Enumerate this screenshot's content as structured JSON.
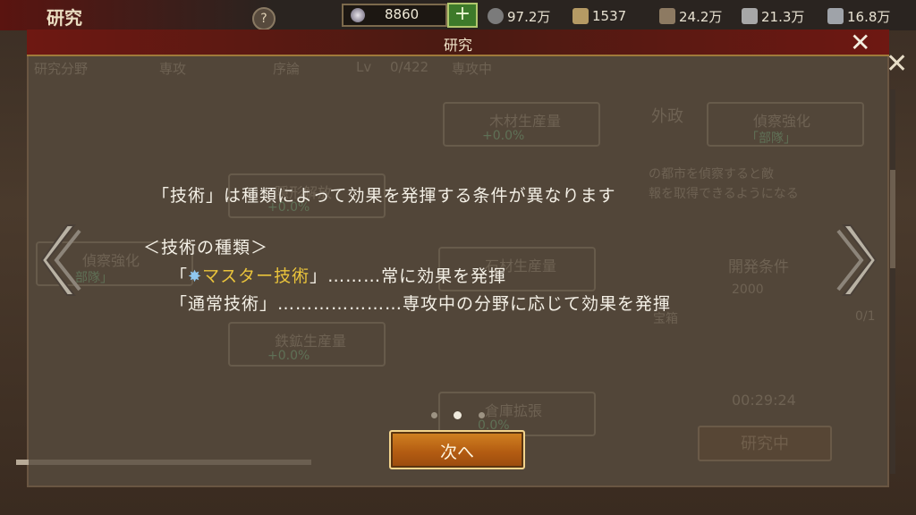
{
  "background": {
    "title": "研究",
    "help_label": "?",
    "gold": "8860",
    "plus_label": "+",
    "resources": [
      {
        "icon": "food-icon",
        "value": "97.2万"
      },
      {
        "icon": "scroll-icon",
        "value": "1537"
      },
      {
        "icon": "wood-icon",
        "value": "24.2万"
      },
      {
        "icon": "ore-icon",
        "value": "21.3万"
      },
      {
        "icon": "iron-icon",
        "value": "16.8万"
      }
    ],
    "tree_header": [
      "研究分野",
      "専攻",
      "序論",
      "Lv",
      "0/422",
      "専攻中"
    ],
    "nodes": [
      {
        "name": "木材生産量",
        "value": "+0.0%"
      },
      {
        "name": "偵察強化",
        "value": "「部隊」"
      },
      {
        "name": "偵察強化",
        "value": "部隊」"
      },
      {
        "name": "鉄鉱生産量",
        "value": "+0.0%"
      },
      {
        "name": "倉庫拡張",
        "value": "0.0%"
      },
      {
        "name": "石材生産量",
        "value": ""
      },
      {
        "name": "隠形解放",
        "value": "+0.0%"
      }
    ],
    "side_labels": [
      "外政",
      "開発条件",
      "2000",
      "宝箱",
      "0/1",
      "00:29:24"
    ],
    "side_desc": "の都市を偵察すると敵\n報を取得できるようになる",
    "research_button": "研究中",
    "close_label": "✕"
  },
  "dialog": {
    "title": "研究",
    "close_label": "✕",
    "line1": "「技術」は種類によって効果を発揮する条件が異なります",
    "line2": "＜技術の種類＞",
    "line3_open": "「",
    "line3_master": "マスター技術",
    "line3_rest": "」………常に効果を発揮",
    "line4": "「通常技術」…………………専攻中の分野に応じて効果を発揮",
    "star_glyph": "✸",
    "next_label": "次へ",
    "page_total": 3,
    "page_current": 2
  },
  "colors": {
    "header": "#6e1812",
    "master_text": "#e9c33b",
    "button": "#c8731b"
  }
}
